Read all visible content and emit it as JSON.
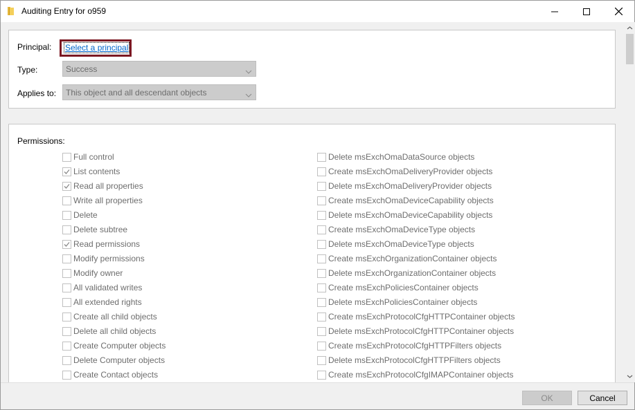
{
  "window": {
    "title": "Auditing Entry for o959",
    "icon": "folder-icon"
  },
  "principal": {
    "label": "Principal:",
    "link": "Select a principal"
  },
  "type": {
    "label": "Type:",
    "value": "Success"
  },
  "applies_to": {
    "label": "Applies to:",
    "value": "This object and all descendant objects"
  },
  "permissions": {
    "label": "Permissions:",
    "left": [
      {
        "label": "Full control",
        "checked": false
      },
      {
        "label": "List contents",
        "checked": true
      },
      {
        "label": "Read all properties",
        "checked": true
      },
      {
        "label": "Write all properties",
        "checked": false
      },
      {
        "label": "Delete",
        "checked": false
      },
      {
        "label": "Delete subtree",
        "checked": false
      },
      {
        "label": "Read permissions",
        "checked": true
      },
      {
        "label": "Modify permissions",
        "checked": false
      },
      {
        "label": "Modify owner",
        "checked": false
      },
      {
        "label": "All validated writes",
        "checked": false
      },
      {
        "label": "All extended rights",
        "checked": false
      },
      {
        "label": "Create all child objects",
        "checked": false
      },
      {
        "label": "Delete all child objects",
        "checked": false
      },
      {
        "label": "Create Computer objects",
        "checked": false
      },
      {
        "label": "Delete Computer objects",
        "checked": false
      },
      {
        "label": "Create Contact objects",
        "checked": false
      }
    ],
    "right": [
      {
        "label": "Delete msExchOmaDataSource objects",
        "checked": false
      },
      {
        "label": "Create msExchOmaDeliveryProvider objects",
        "checked": false
      },
      {
        "label": "Delete msExchOmaDeliveryProvider objects",
        "checked": false
      },
      {
        "label": "Create msExchOmaDeviceCapability objects",
        "checked": false
      },
      {
        "label": "Delete msExchOmaDeviceCapability objects",
        "checked": false
      },
      {
        "label": "Create msExchOmaDeviceType objects",
        "checked": false
      },
      {
        "label": "Delete msExchOmaDeviceType objects",
        "checked": false
      },
      {
        "label": "Create msExchOrganizationContainer objects",
        "checked": false
      },
      {
        "label": "Delete msExchOrganizationContainer objects",
        "checked": false
      },
      {
        "label": "Create msExchPoliciesContainer objects",
        "checked": false
      },
      {
        "label": "Delete msExchPoliciesContainer objects",
        "checked": false
      },
      {
        "label": "Create msExchProtocolCfgHTTPContainer objects",
        "checked": false
      },
      {
        "label": "Delete msExchProtocolCfgHTTPContainer objects",
        "checked": false
      },
      {
        "label": "Create msExchProtocolCfgHTTPFilters objects",
        "checked": false
      },
      {
        "label": "Delete msExchProtocolCfgHTTPFilters objects",
        "checked": false
      },
      {
        "label": "Create msExchProtocolCfgIMAPContainer objects",
        "checked": false
      }
    ]
  },
  "buttons": {
    "ok": "OK",
    "cancel": "Cancel"
  },
  "colors": {
    "highlight_border": "#7b1722",
    "link": "#0066cc",
    "disabled_text": "#6d6d6d"
  }
}
